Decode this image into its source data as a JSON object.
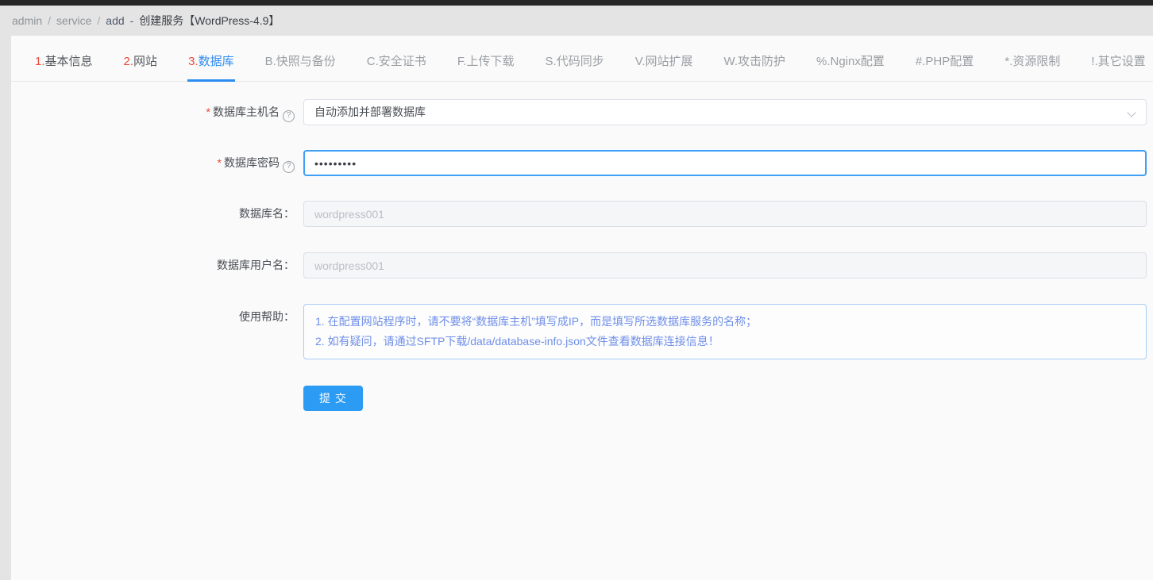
{
  "breadcrumb": {
    "items": [
      "admin",
      "service",
      "add"
    ],
    "separator": "/",
    "dash": "-",
    "title": "创建服务【WordPress-4.9】"
  },
  "tabs": {
    "items": [
      {
        "prefix": "1.",
        "label": "基本信息"
      },
      {
        "prefix": "2.",
        "label": "网站"
      },
      {
        "prefix": "3.",
        "label": "数据库"
      },
      {
        "prefix": "B.",
        "label": "快照与备份"
      },
      {
        "prefix": "C.",
        "label": "安全证书"
      },
      {
        "prefix": "F.",
        "label": "上传下载"
      },
      {
        "prefix": "S.",
        "label": "代码同步"
      },
      {
        "prefix": "V.",
        "label": "网站扩展"
      },
      {
        "prefix": "W.",
        "label": "攻击防护"
      },
      {
        "prefix": "%.",
        "label": "Nginx配置"
      },
      {
        "prefix": "#.",
        "label": "PHP配置"
      },
      {
        "prefix": "*.",
        "label": "资源限制"
      },
      {
        "prefix": "!.",
        "label": "其它设置"
      }
    ],
    "active": "3.数据库"
  },
  "form": {
    "db_host": {
      "label": "数据库主机名",
      "required_mark": "*",
      "help_icon": "?",
      "value": "自动添加并部署数据库"
    },
    "db_password": {
      "label": "数据库密码",
      "required_mark": "*",
      "help_icon": "?",
      "masked_value": "•••••••••"
    },
    "db_name": {
      "label": "数据库名：",
      "placeholder": "wordpress001"
    },
    "db_user": {
      "label": "数据库用户名：",
      "placeholder": "wordpress001"
    },
    "help": {
      "label": "使用帮助：",
      "lines": [
        "1. 在配置网站程序时，请不要将“数据库主机”填写成IP，而是填写所选数据库服务的名称；",
        "2. 如有疑问，请通过SFTP下载/data/database-info.json文件查看数据库连接信息！"
      ]
    },
    "submit_label": "提 交"
  },
  "colors": {
    "accent_blue": "#2d8cf0",
    "tab_number_red": "#e64c3c",
    "button_blue": "#2b9bf4",
    "help_text_blue": "#6f8fe8",
    "focus_border_blue": "#3ea0f7"
  }
}
